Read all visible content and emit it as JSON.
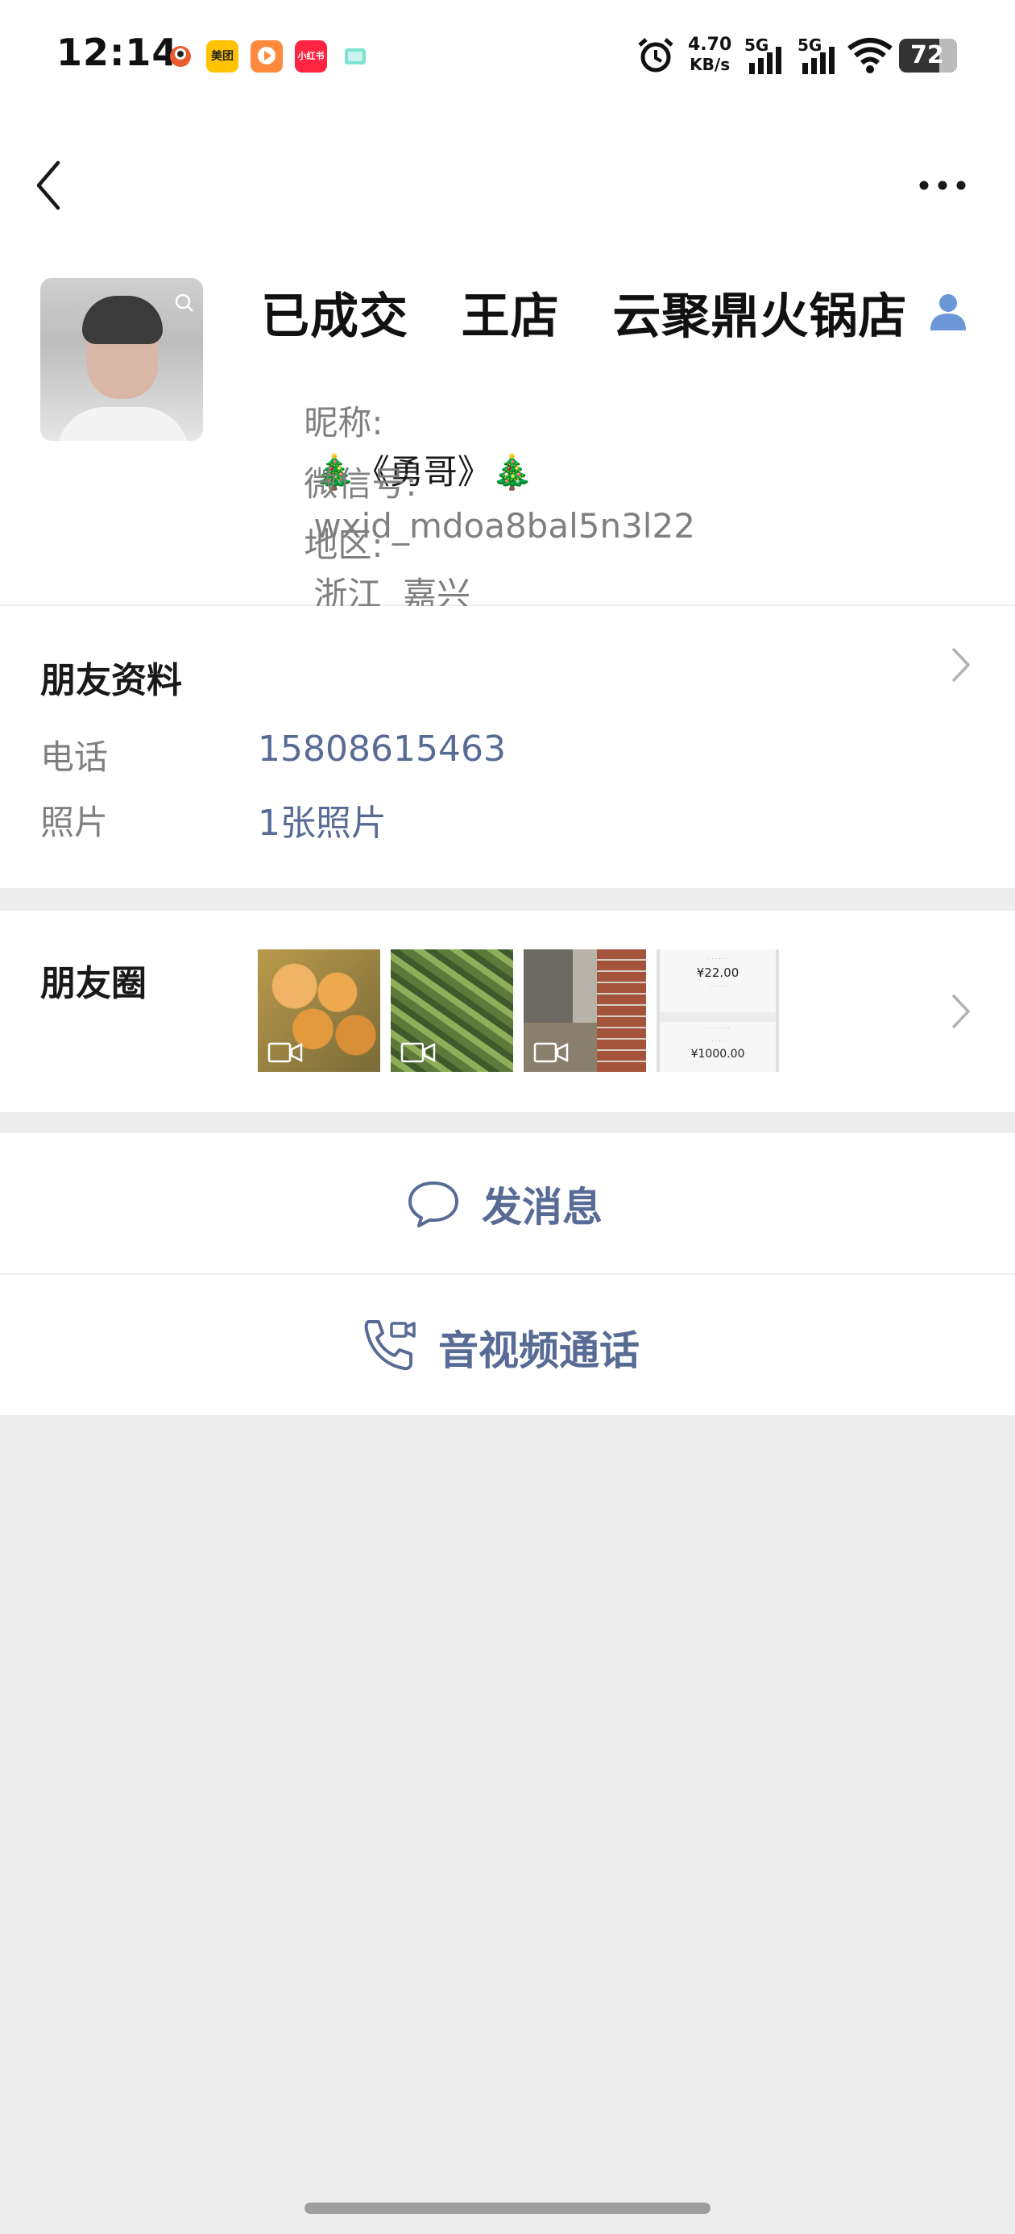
{
  "status_bar": {
    "time": "12:14",
    "apps": [
      {
        "name": "app-icon-1",
        "label": "",
        "color": "#e85c2e"
      },
      {
        "name": "meituan-icon",
        "label": "美团",
        "color": "#ffc300"
      },
      {
        "name": "video-app-icon",
        "label": "",
        "color": "#ff8a3d"
      },
      {
        "name": "xiaohongshu-icon",
        "label": "小红书",
        "color": "#ff2442"
      },
      {
        "name": "message-app-icon",
        "label": "",
        "color": "#7ee2d2"
      }
    ],
    "net_speed_value": "4.70",
    "net_speed_unit": "KB/s",
    "signal_1": "5G",
    "signal_2": "5G",
    "battery": "72"
  },
  "profile": {
    "display_name": "已成交   王店   云聚鼎火锅店",
    "nickname_label": "昵称:",
    "nickname_value": "🎄《勇哥》🎄",
    "wechat_id_label": "微信号:",
    "wechat_id_value": "wxid_mdoa8bal5n3l22",
    "region_label": "地区:",
    "region_value": "浙江  嘉兴"
  },
  "friend_info": {
    "title": "朋友资料",
    "phone_label": "电话",
    "phone_value": "15808615463",
    "photos_label": "照片",
    "photos_value": "1张照片"
  },
  "moments": {
    "title": "朋友圈",
    "receipt": {
      "amount_top": "¥22.00",
      "amount_bottom": "¥1000.00"
    }
  },
  "actions": {
    "send_message": "发消息",
    "av_call": "音视频通话"
  },
  "colors": {
    "link": "#576b95",
    "background": "#ededed",
    "contact_icon": "#6b97d6"
  }
}
